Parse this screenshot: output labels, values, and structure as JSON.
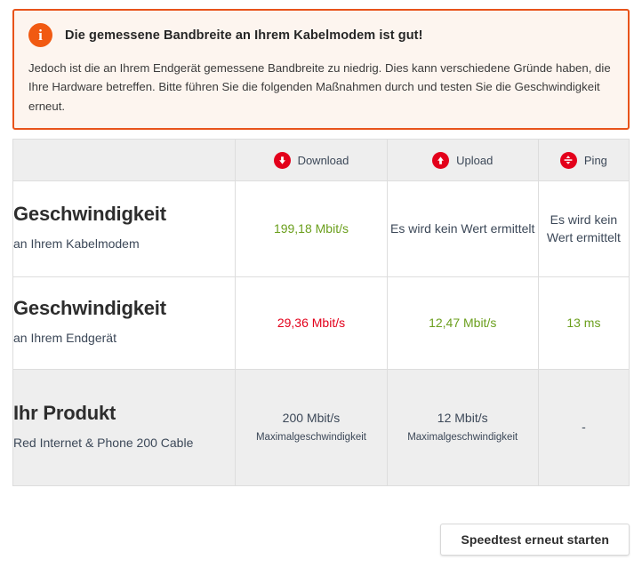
{
  "alert": {
    "icon": "info-icon",
    "icon_glyph": "i",
    "title": "Die gemessene Bandbreite an Ihrem Kabelmodem ist gut!",
    "body": "Jedoch ist die an Ihrem Endgerät gemessene Bandbreite zu niedrig. Dies kann verschiedene Gründe haben, die Ihre Hardware betreffen. Bitte führen Sie die folgenden Maßnahmen durch und testen Sie die Geschwindigkeit erneut.",
    "border_color": "#e8531a",
    "background_color": "#fdf5ef",
    "icon_color": "#f15a12"
  },
  "table": {
    "columns": [
      {
        "label": "",
        "icon": ""
      },
      {
        "label": "Download",
        "icon": "download-arrow-icon"
      },
      {
        "label": "Upload",
        "icon": "upload-arrow-icon"
      },
      {
        "label": "Ping",
        "icon": "ping-arrows-icon"
      }
    ],
    "rows": [
      {
        "title": "Geschwindigkeit",
        "subtitle": "an Ihrem Kabelmodem",
        "download": {
          "value": "199,18 Mbit/s",
          "note": "",
          "state": "green"
        },
        "upload": {
          "value": "Es wird kein Wert ermittelt",
          "note": "",
          "state": "neutral"
        },
        "ping": {
          "value": "Es wird kein Wert ermittelt",
          "note": "",
          "state": "neutral"
        }
      },
      {
        "title": "Geschwindigkeit",
        "subtitle": "an Ihrem Endgerät",
        "download": {
          "value": "29,36 Mbit/s",
          "note": "",
          "state": "red"
        },
        "upload": {
          "value": "12,47 Mbit/s",
          "note": "",
          "state": "green"
        },
        "ping": {
          "value": "13 ms",
          "note": "",
          "state": "green"
        }
      },
      {
        "title": "Ihr Produkt",
        "subtitle": "Red Internet & Phone 200 Cable",
        "download": {
          "value": "200 Mbit/s",
          "note": "Maximalgeschwindigkeit",
          "state": "neutral"
        },
        "upload": {
          "value": "12 Mbit/s",
          "note": "Maximalgeschwindigkeit",
          "state": "neutral"
        },
        "ping": {
          "value": "-",
          "note": "",
          "state": "neutral"
        }
      }
    ],
    "header_background": "#eeeeee",
    "metric_icon_color": "#e3001b",
    "green_color": "#6b9f1d",
    "red_color": "#e3001b"
  },
  "footer": {
    "restart_button_label": "Speedtest erneut starten"
  }
}
